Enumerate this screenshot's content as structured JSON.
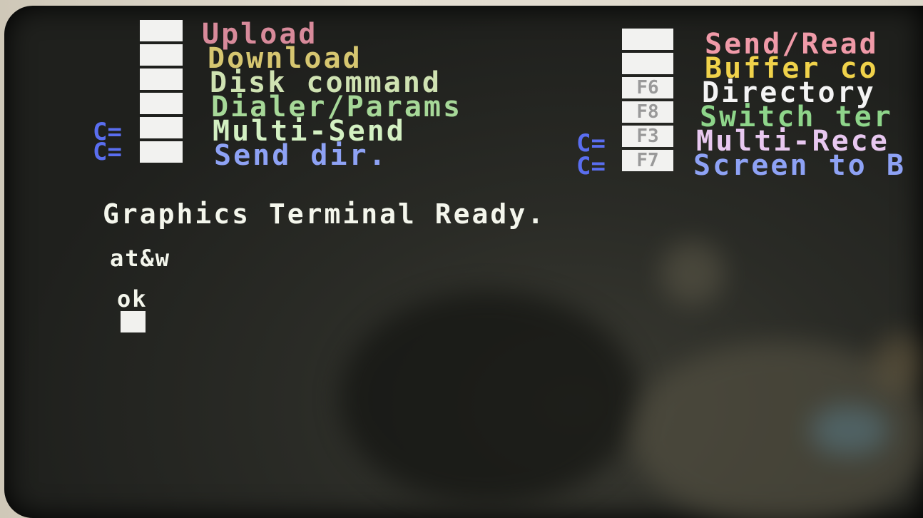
{
  "menu": {
    "left": [
      {
        "key": "",
        "mod": "",
        "label": "Upload",
        "color": "#d88a9a"
      },
      {
        "key": "",
        "mod": "",
        "label": "Download",
        "color": "#d6c670"
      },
      {
        "key": "",
        "mod": "",
        "label": "Disk command",
        "color": "#cfe2b2"
      },
      {
        "key": "",
        "mod": "",
        "label": "Dialer/Params",
        "color": "#a6d898"
      },
      {
        "key": "",
        "mod": "C=",
        "label": "Multi-Send",
        "color": "#d3f0c2"
      },
      {
        "key": "",
        "mod": "C=",
        "label": "Send dir.",
        "color": "#8ea2f5"
      }
    ],
    "right": [
      {
        "key": "",
        "mod": "",
        "label": "Send/Read",
        "color": "#f09aa8"
      },
      {
        "key": "",
        "mod": "",
        "label": "Buffer co",
        "color": "#f0d24a"
      },
      {
        "key": "F6",
        "mod": "",
        "label": "Directory",
        "color": "#f4f4f4"
      },
      {
        "key": "F8",
        "mod": "",
        "label": "Switch ter",
        "color": "#8ed58a"
      },
      {
        "key": "F3",
        "mod": "C=",
        "label": "Multi-Rece",
        "color": "#e8c8f0"
      },
      {
        "key": "F7",
        "mod": "C=",
        "label": "Screen to B",
        "color": "#8ea2f5"
      }
    ]
  },
  "terminal": {
    "status": "Graphics Terminal Ready.",
    "command": "at&w",
    "response": "ok"
  }
}
